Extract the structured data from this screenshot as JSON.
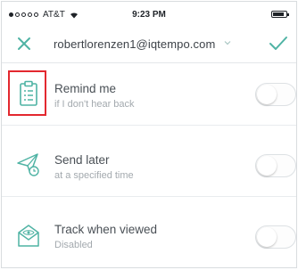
{
  "status_bar": {
    "carrier": "AT&T",
    "time": "9:23 PM",
    "battery_level": 0.85
  },
  "header": {
    "account_email": "robertlorenzen1@iqtempo.com",
    "close_icon": "close-icon",
    "dropdown_icon": "chevron-down-icon",
    "confirm_icon": "checkmark-icon"
  },
  "options": [
    {
      "title": "Remind me",
      "subtitle": "if I don't hear back",
      "icon": "clipboard-icon",
      "enabled": false,
      "highlighted": true
    },
    {
      "title": "Send later",
      "subtitle": "at a specified time",
      "icon": "paper-plane-clock-icon",
      "enabled": false,
      "highlighted": false
    },
    {
      "title": "Track when viewed",
      "subtitle": "Disabled",
      "icon": "envelope-eye-icon",
      "enabled": false,
      "highlighted": false
    }
  ],
  "colors": {
    "accent": "#4fb3a4",
    "highlight_box": "#e3282f"
  }
}
